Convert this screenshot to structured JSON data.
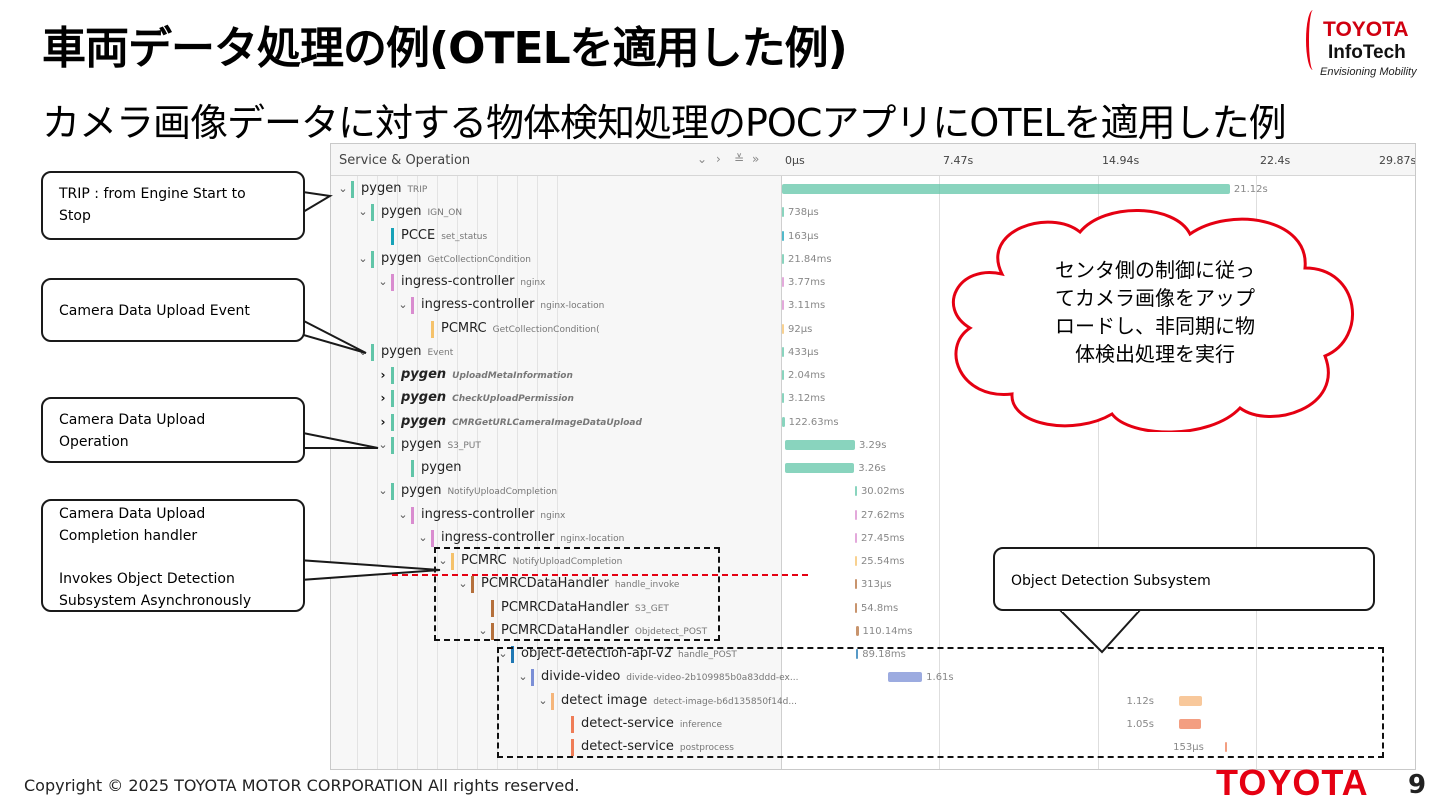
{
  "slide": {
    "title": "車両データ処理の例(OTELを適用した例)",
    "subtitle": "カメラ画像データに対する物体検知処理のPOCアプリにOTELを適用した例",
    "copyright": "Copyright ©  2025 TOYOTA MOTOR CORPORATION All rights reserved.",
    "footer_logo": "TOYOTA",
    "page_number": "9"
  },
  "brand_logo": {
    "line1": "TOYOTA",
    "line2": "InfoTech",
    "tagline": "Envisioning Mobility"
  },
  "trace_viewer": {
    "header_label": "Service & Operation",
    "controls": [
      "⌄",
      "›",
      "≚",
      "»"
    ],
    "ticks": [
      "0μs",
      "7.47s",
      "14.94s",
      "22.4s",
      "29.87s"
    ],
    "rows": [
      {
        "service": "pygen",
        "operation": "TRIP",
        "duration": "21.12s",
        "depth": 0,
        "chevron": "⌄",
        "bold": false,
        "color": "#61c5a8"
      },
      {
        "service": "pygen",
        "operation": "IGN_ON",
        "duration": "738μs",
        "depth": 1,
        "chevron": "⌄",
        "bold": false,
        "color": "#61c5a8"
      },
      {
        "service": "PCCE",
        "operation": "set_status",
        "duration": "163μs",
        "depth": 2,
        "chevron": "",
        "bold": false,
        "color": "#17a2b8"
      },
      {
        "service": "pygen",
        "operation": "GetCollectionCondition",
        "duration": "21.84ms",
        "depth": 1,
        "chevron": "⌄",
        "bold": false,
        "color": "#61c5a8"
      },
      {
        "service": "ingress-controller",
        "operation": "nginx",
        "duration": "3.77ms",
        "depth": 2,
        "chevron": "⌄",
        "bold": false,
        "color": "#d98ccf"
      },
      {
        "service": "ingress-controller",
        "operation": "nginx-location",
        "duration": "3.11ms",
        "depth": 3,
        "chevron": "⌄",
        "bold": false,
        "color": "#d98ccf"
      },
      {
        "service": "PCMRC",
        "operation": "GetCollectionCondition(",
        "duration": "92μs",
        "depth": 4,
        "chevron": "",
        "bold": false,
        "color": "#f5c26b"
      },
      {
        "service": "pygen",
        "operation": "Event",
        "duration": "433μs",
        "depth": 1,
        "chevron": "⌄",
        "bold": false,
        "color": "#61c5a8"
      },
      {
        "service": "pygen",
        "operation": "UploadMetaInformation",
        "duration": "2.04ms",
        "depth": 2,
        "chevron": "›",
        "bold": true,
        "color": "#61c5a8"
      },
      {
        "service": "pygen",
        "operation": "CheckUploadPermission",
        "duration": "3.12ms",
        "depth": 2,
        "chevron": "›",
        "bold": true,
        "color": "#61c5a8"
      },
      {
        "service": "pygen",
        "operation": "CMRGetURLCameraImageDataUpload",
        "duration": "122.63ms",
        "depth": 2,
        "chevron": "›",
        "bold": true,
        "color": "#61c5a8"
      },
      {
        "service": "pygen",
        "operation": "S3_PUT",
        "duration": "3.29s",
        "depth": 2,
        "chevron": "⌄",
        "bold": false,
        "color": "#61c5a8"
      },
      {
        "service": "pygen",
        "operation": "",
        "duration": "3.26s",
        "depth": 3,
        "chevron": "",
        "bold": false,
        "color": "#61c5a8"
      },
      {
        "service": "pygen",
        "operation": "NotifyUploadCompletion",
        "duration": "30.02ms",
        "depth": 2,
        "chevron": "⌄",
        "bold": false,
        "color": "#61c5a8"
      },
      {
        "service": "ingress-controller",
        "operation": "nginx",
        "duration": "27.62ms",
        "depth": 3,
        "chevron": "⌄",
        "bold": false,
        "color": "#d98ccf"
      },
      {
        "service": "ingress-controller",
        "operation": "nginx-location",
        "duration": "27.45ms",
        "depth": 4,
        "chevron": "⌄",
        "bold": false,
        "color": "#d98ccf"
      },
      {
        "service": "PCMRC",
        "operation": "NotifyUploadCompletion",
        "duration": "25.54ms",
        "depth": 5,
        "chevron": "⌄",
        "bold": false,
        "color": "#f5c26b"
      },
      {
        "service": "PCMRCDataHandler",
        "operation": "handle_invoke",
        "duration": "313μs",
        "depth": 6,
        "chevron": "⌄",
        "bold": false,
        "color": "#b5703c"
      },
      {
        "service": "PCMRCDataHandler",
        "operation": "S3_GET",
        "duration": "54.8ms",
        "depth": 7,
        "chevron": "",
        "bold": false,
        "color": "#b5703c"
      },
      {
        "service": "PCMRCDataHandler",
        "operation": "Objdetect_POST",
        "duration": "110.14ms",
        "depth": 7,
        "chevron": "⌄",
        "bold": false,
        "color": "#b5703c"
      },
      {
        "service": "object-detection-api-v2",
        "operation": "handle_POST",
        "duration": "89.18ms",
        "depth": 8,
        "chevron": "⌄",
        "bold": false,
        "color": "#1f78b4"
      },
      {
        "service": "divide-video",
        "operation": "divide-video-2b109985b0a83ddd-ex...",
        "duration": "1.61s",
        "depth": 9,
        "chevron": "⌄",
        "bold": false,
        "color": "#7b8fd6"
      },
      {
        "service": "detect image",
        "operation": "detect-image-b6d135850f14d...",
        "duration": "1.12s",
        "depth": 10,
        "chevron": "⌄",
        "bold": false,
        "color": "#f5b57a"
      },
      {
        "service": "detect-service",
        "operation": "inference",
        "duration": "1.05s",
        "depth": 11,
        "chevron": "",
        "bold": false,
        "color": "#ef7d57"
      },
      {
        "service": "detect-service",
        "operation": "postprocess",
        "duration": "153μs",
        "depth": 11,
        "chevron": "",
        "bold": false,
        "color": "#ef7d57"
      }
    ]
  },
  "callouts": {
    "trip": "TRIP : from Engine Start to\nStop",
    "upload_event": "Camera Data Upload Event",
    "upload_operation": "Camera Data Upload\nOperation",
    "completion_line1": "Camera Data Upload",
    "completion_line2": "Completion handler",
    "completion_line3": "Invokes Object Detection",
    "completion_line4": "Subsystem Asynchronously",
    "object_detection": "Object Detection Subsystem"
  },
  "cloud": {
    "text": "センタ側の制御に従ってカメラ画像をアップロードし、非同期に物体検出処理を実行",
    "line1": "センタ側の制御に従っ",
    "line2": "てカメラ画像をアップ",
    "line3": "ロードし、非同期に物",
    "line4": "体検出処理を実行"
  }
}
